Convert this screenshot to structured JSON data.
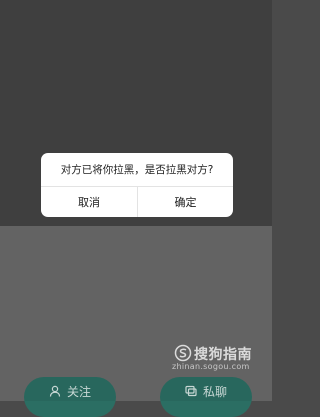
{
  "dialog": {
    "message": "对方已将你拉黑，是否拉黑对方?",
    "cancel_label": "取消",
    "confirm_label": "确定"
  },
  "actions": {
    "follow_label": "关注",
    "message_label": "私聊"
  },
  "watermark": {
    "title": "搜狗指南",
    "url": "zhinan.sogou.com"
  },
  "colors": {
    "action_button": "#2b6e63",
    "dialog_bg": "#ffffff"
  },
  "icons": {
    "follow": "person-icon",
    "message": "chat-bubble-icon",
    "watermark_logo": "sogou-logo-icon"
  }
}
